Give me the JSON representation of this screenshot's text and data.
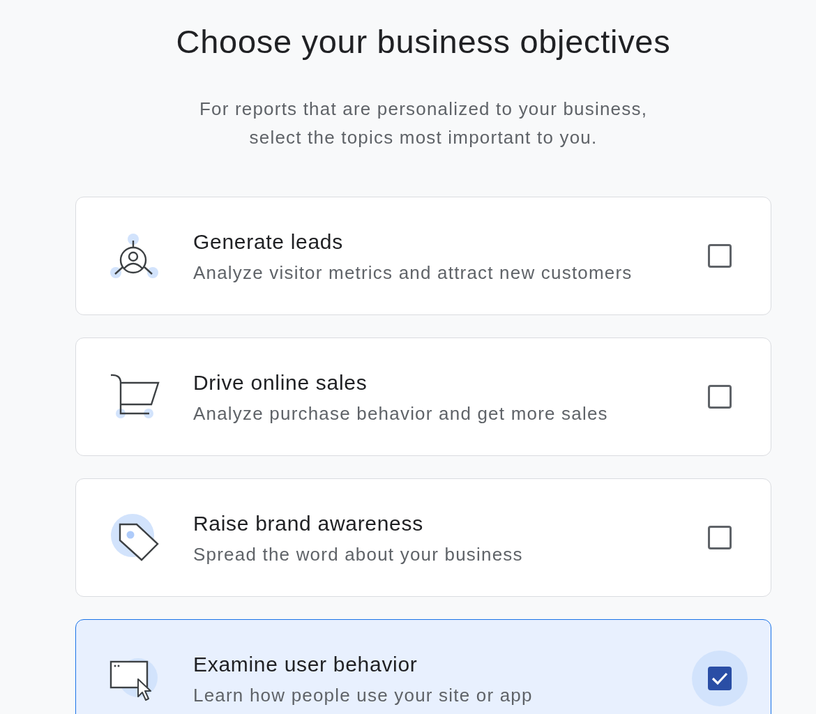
{
  "title": "Choose your business objectives",
  "subtitle": "For reports that are personalized to your business,\nselect the topics most important to you.",
  "objectives": [
    {
      "kind": "leads",
      "title": "Generate leads",
      "description": "Analyze visitor metrics and attract new customers",
      "checked": false
    },
    {
      "kind": "sales",
      "title": "Drive online sales",
      "description": "Analyze purchase behavior and get more sales",
      "checked": false
    },
    {
      "kind": "brand",
      "title": "Raise brand awareness",
      "description": "Spread the word about your business",
      "checked": false
    },
    {
      "kind": "behavior",
      "title": "Examine user behavior",
      "description": "Learn how people use your site or app",
      "checked": true
    }
  ]
}
